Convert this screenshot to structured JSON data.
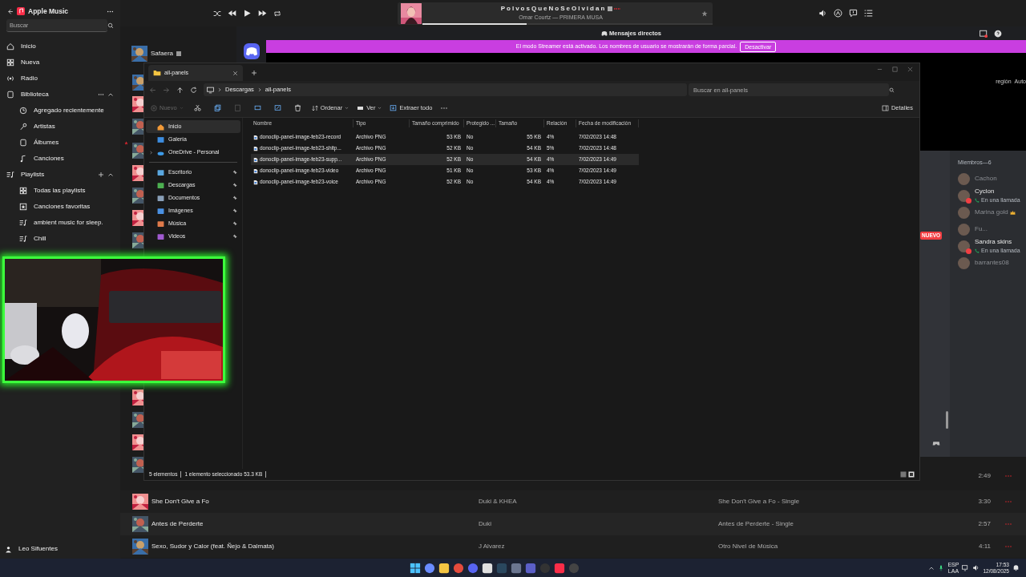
{
  "music": {
    "app_title": "Apple Music",
    "search": {
      "placeholder": "Buscar"
    },
    "nav": [
      {
        "label": "Inicio"
      },
      {
        "label": "Nueva"
      },
      {
        "label": "Radio"
      }
    ],
    "sections": [
      {
        "label": "Biblioteca",
        "items": [
          {
            "label": "Agregado recientemente"
          },
          {
            "label": "Artistas"
          },
          {
            "label": "Álbumes"
          },
          {
            "label": "Canciones"
          }
        ]
      },
      {
        "label": "Playlists",
        "items": [
          {
            "label": "Todas las playlists"
          },
          {
            "label": "Canciones favoritas"
          },
          {
            "label": "ambient music for sleep."
          },
          {
            "label": "Chill"
          }
        ]
      }
    ],
    "user": "Leo Sifuentes",
    "now_playing": {
      "title": "PolvosQueNoSeOlvidan",
      "subtitle": "Omar Courtz — PRIMERA MUSA",
      "level": 0.36
    },
    "side_song": "Safaera",
    "tracks": [
      {
        "time": "2:49"
      },
      {
        "title": "She Don't Give a Fo",
        "artist": "Duki & KHEA",
        "album": "She Don't Give a Fo - Single",
        "time": "3:30"
      },
      {
        "title": "Antes de Perderte",
        "artist": "Duki",
        "album": "Antes de Perderte - Single",
        "time": "2:57"
      },
      {
        "title": "Sexo, Sudor y Calor (feat. Ñejo & Dalmata)",
        "artist": "J Alvarez",
        "album": "Otro Nivel de Música",
        "time": "4:11"
      }
    ]
  },
  "discord": {
    "title": "Mensajes directos",
    "banner": "El modo Streamer está activado. Los nombres de usuario se mostrarán de forma parcial.",
    "banner_button": "Desactivar",
    "top_right": [
      "región",
      "Auto"
    ],
    "new_badge": "NUEVO",
    "members_header": "Miembros—6",
    "members": [
      {
        "name": "Cachon",
        "offline": true
      },
      {
        "name": "Cyclon",
        "status": "En una llamada",
        "offline": false
      },
      {
        "name": "Marina gold",
        "offline": true,
        "owner": true
      },
      {
        "name": "Fu...",
        "offline": true
      },
      {
        "name": "Sandra skins",
        "status": "En una llamada",
        "offline": false
      },
      {
        "name": "barrantes08",
        "offline": true
      }
    ]
  },
  "explorer": {
    "tab": "all-panels",
    "breadcrumb": [
      "Descargas",
      "all-panels"
    ],
    "search": {
      "placeholder": "Buscar en all-panels"
    },
    "toolbar": {
      "new": "Nuevo",
      "sort": "Ordenar",
      "view": "Ver",
      "extract": "Extraer todo",
      "details": "Detalles"
    },
    "nav_top": [
      {
        "label": "Inicio",
        "selected": true,
        "expandable": false
      },
      {
        "label": "Galería",
        "selected": false,
        "expandable": false
      },
      {
        "label": "OneDrive - Personal",
        "selected": false,
        "expandable": true
      }
    ],
    "nav_quick": [
      {
        "label": "Escritorio",
        "pinned": true
      },
      {
        "label": "Descargas",
        "pinned": true
      },
      {
        "label": "Documentos",
        "pinned": true
      },
      {
        "label": "Imágenes",
        "pinned": true
      },
      {
        "label": "Música",
        "pinned": true
      },
      {
        "label": "Videos",
        "pinned": true
      }
    ],
    "columns": [
      "Nombre",
      "Tipo",
      "Tamaño comprimido",
      "Protegido ...",
      "Tamaño",
      "Relación",
      "Fecha de modificación"
    ],
    "rows": [
      {
        "cells": [
          "donoclip-panel-image-feb23-record",
          "Archivo PNG",
          "53 KB",
          "No",
          "55 KB",
          "4%",
          "7/02/2023 14:48"
        ],
        "selected": false
      },
      {
        "cells": [
          "donoclip-panel-image-feb23-shitp...",
          "Archivo PNG",
          "52 KB",
          "No",
          "54 KB",
          "5%",
          "7/02/2023 14:48"
        ],
        "selected": false
      },
      {
        "cells": [
          "donoclip-panel-image-feb23-supp...",
          "Archivo PNG",
          "52 KB",
          "No",
          "54 KB",
          "4%",
          "7/02/2023 14:49"
        ],
        "selected": true
      },
      {
        "cells": [
          "donoclip-panel-image-feb23-video",
          "Archivo PNG",
          "51 KB",
          "No",
          "53 KB",
          "4%",
          "7/02/2023 14:49"
        ],
        "selected": false
      },
      {
        "cells": [
          "donoclip-panel-image-feb23-voice",
          "Archivo PNG",
          "52 KB",
          "No",
          "54 KB",
          "4%",
          "7/02/2023 14:49"
        ],
        "selected": false
      }
    ],
    "status": [
      "5 elementos",
      "1 elemento seleccionado  53.3 KB"
    ]
  },
  "taskbar": {
    "language": "ESP",
    "layout": "LAA",
    "time": "17:53",
    "date": "12/08/2025"
  }
}
